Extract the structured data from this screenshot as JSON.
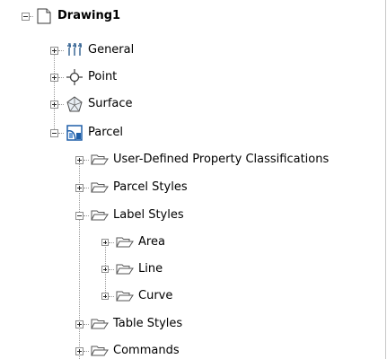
{
  "tree": {
    "root": {
      "label": "Drawing1",
      "icon": "document-icon",
      "expanded": true
    },
    "collections": [
      {
        "label": "General",
        "icon": "tools-icon",
        "expanded": false
      },
      {
        "label": "Point",
        "icon": "point-crosshair-icon",
        "expanded": false
      },
      {
        "label": "Surface",
        "icon": "surface-icon",
        "expanded": false
      },
      {
        "label": "Parcel",
        "icon": "parcel-icon",
        "expanded": true
      }
    ],
    "parcel_children": [
      {
        "label": "User-Defined Property Classifications",
        "icon": "folder-icon",
        "expanded": false
      },
      {
        "label": "Parcel Styles",
        "icon": "folder-icon",
        "expanded": false
      },
      {
        "label": "Label Styles",
        "icon": "folder-icon",
        "expanded": true
      },
      {
        "label": "Table Styles",
        "icon": "folder-icon",
        "expanded": false
      },
      {
        "label": "Commands",
        "icon": "folder-icon",
        "expanded": false
      }
    ],
    "label_style_children": [
      {
        "label": "Area",
        "icon": "folder-icon",
        "expanded": false
      },
      {
        "label": "Line",
        "icon": "folder-icon",
        "expanded": false
      },
      {
        "label": "Curve",
        "icon": "folder-icon",
        "expanded": false
      }
    ]
  }
}
